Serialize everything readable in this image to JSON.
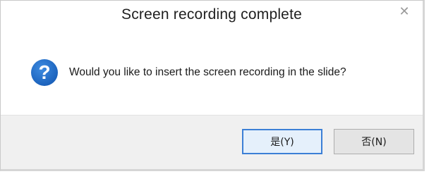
{
  "dialog": {
    "title": "Screen recording complete",
    "close_glyph": "✕",
    "message": "Would you like to insert the screen recording in the slide?",
    "icon": {
      "name": "question-icon",
      "glyph": "?",
      "color": "#1c63bd"
    },
    "buttons": {
      "yes_label": "是(Y)",
      "no_label": "否(N)"
    }
  }
}
